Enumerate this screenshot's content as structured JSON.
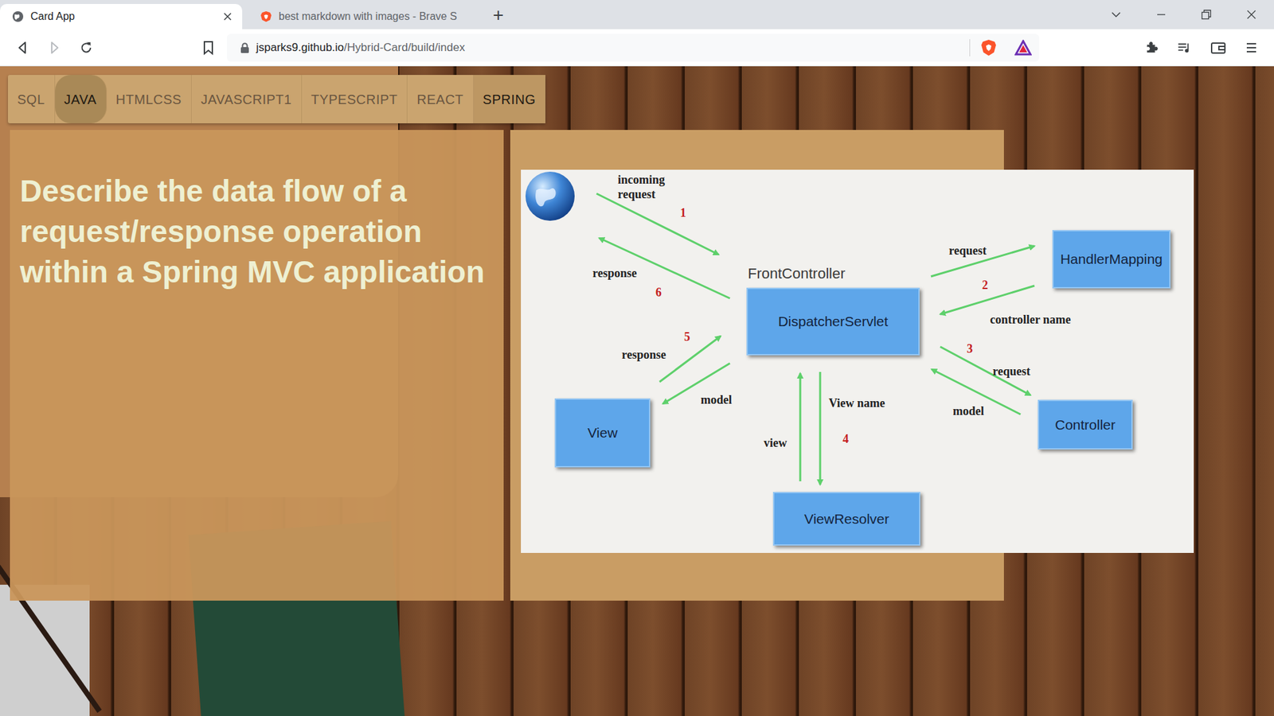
{
  "window": {
    "tabs": [
      {
        "title": "Card App",
        "selected": true
      },
      {
        "title": "best markdown with images - Brave S",
        "selected": false
      }
    ],
    "new_tab_button": "+"
  },
  "toolbar": {
    "url_host": "jsparks9.github.io",
    "url_path": "/Hybrid-Card/build/index",
    "back_enabled": true,
    "forward_enabled": false
  },
  "nav": [
    {
      "label": "SQL",
      "selected": false,
      "hovered": false
    },
    {
      "label": "JAVA",
      "selected": false,
      "hovered": true
    },
    {
      "label": "HTMLCSS",
      "selected": false,
      "hovered": false
    },
    {
      "label": "JAVASCRIPT1",
      "selected": false,
      "hovered": false
    },
    {
      "label": "TYPESCRIPT",
      "selected": false,
      "hovered": false
    },
    {
      "label": "REACT",
      "selected": false,
      "hovered": false
    },
    {
      "label": "SPRING",
      "selected": true,
      "hovered": false
    }
  ],
  "question": "Describe the data flow of a request/response operation within a Spring MVC application",
  "diagram": {
    "front_controller_label": "FrontController",
    "boxes": [
      {
        "label": "DispatcherServlet"
      },
      {
        "label": "HandlerMapping"
      },
      {
        "label": "Controller"
      },
      {
        "label": "View"
      },
      {
        "label": "ViewResolver"
      }
    ],
    "labels": [
      {
        "text": "incoming request",
        "kind": "label"
      },
      {
        "text": "1",
        "kind": "step"
      },
      {
        "text": "response",
        "kind": "label"
      },
      {
        "text": "6",
        "kind": "step"
      },
      {
        "text": "5",
        "kind": "step"
      },
      {
        "text": "response",
        "kind": "label"
      },
      {
        "text": "model",
        "kind": "label"
      },
      {
        "text": "request",
        "kind": "label"
      },
      {
        "text": "2",
        "kind": "step"
      },
      {
        "text": "controller name",
        "kind": "label"
      },
      {
        "text": "3",
        "kind": "step"
      },
      {
        "text": "request",
        "kind": "label"
      },
      {
        "text": "model",
        "kind": "label"
      },
      {
        "text": "View name",
        "kind": "label"
      },
      {
        "text": "4",
        "kind": "step"
      },
      {
        "text": "view",
        "kind": "label"
      }
    ]
  }
}
